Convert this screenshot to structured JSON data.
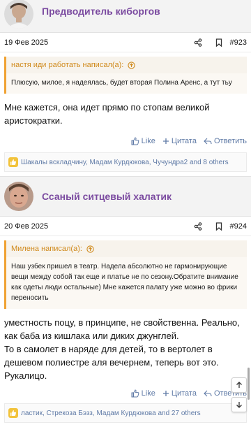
{
  "posts": [
    {
      "username": "Предводитель киборгов",
      "date": "19 Фев 2025",
      "number": "#923",
      "quote_author": "настя иди работать написал(а):",
      "quote_text": "Плюсую, милое, я надеялась, будет вторая Полина Аренс, а тут тьу",
      "body": "Мне кажется, она идет прямо по стопам великой аристократки.",
      "like_label": "Like",
      "quote_label": "Цитата",
      "reply_label": "Ответить",
      "reactions": "Шакалы вскладчину, Мадам Курдюкова, Чучундра2 and 8 others"
    },
    {
      "username": "Ссаный ситцевый халатик",
      "date": "20 Фев 2025",
      "number": "#924",
      "quote_author": "Милена написал(а):",
      "quote_text": "Наш узбек пришел в театр. Надела абсолютно не гармонирующие вещи между собой так еще и платье не по сезону.Обратите внимание как одеты люди остальные) Мне кажется палату уже можно во фрики переносить",
      "body": "уместность поцу, в принципе, не свойственна. Реально, как баба из кишлака или диких джунглей.\nТо в самолет в наряде для детей, то в вертолет в дешевом полиестре аля вечернем, теперь вот это. Рукалицо.",
      "like_label": "Like",
      "quote_label": "Цитата",
      "reply_label": "Ответить",
      "reactions": "ластик, Стрекоза Бэзз, Мадам Курдюкова and 27 others"
    }
  ],
  "colors": {
    "username": "#7b4ba0",
    "quote_accent": "#f0a233",
    "action": "#5f7aa6",
    "reaction_badge": "#f2c33c"
  },
  "icons": [
    "share-icon",
    "bookmark-icon",
    "quote-arrow-icon",
    "like-icon",
    "plus-icon",
    "reply-icon",
    "thumbs-up-icon",
    "scroll-up-icon",
    "scroll-down-icon"
  ]
}
